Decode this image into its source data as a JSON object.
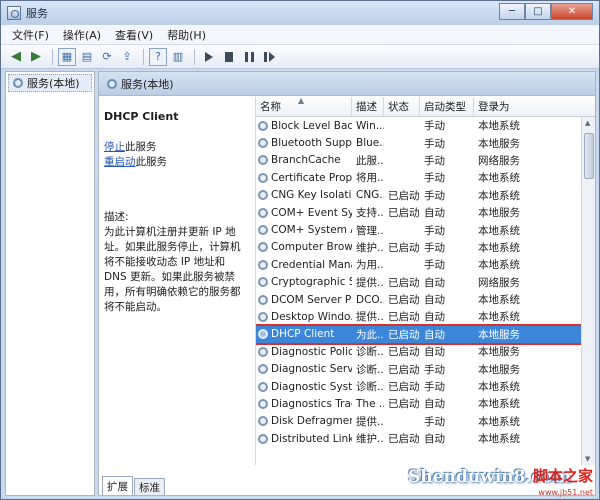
{
  "window": {
    "title": "服务"
  },
  "title_buttons": {
    "minimize": "─",
    "maximize": "□",
    "close": "✕"
  },
  "menu": [
    "文件(F)",
    "操作(A)",
    "查看(V)",
    "帮助(H)"
  ],
  "tree": {
    "root": "服务(本地)"
  },
  "main": {
    "header": "服务(本地)",
    "service_name": "DHCP Client",
    "stop_link": "停止",
    "stop_suffix": "此服务",
    "restart_link": "重启动",
    "restart_suffix": "此服务",
    "description_label": "描述:",
    "description": "为此计算机注册并更新 IP 地址。如果此服务停止，计算机将不能接收动态 IP 地址和 DNS 更新。如果此服务被禁用，所有明确依赖它的服务都将不能启动。"
  },
  "columns": [
    "名称",
    "描述",
    "状态",
    "启动类型",
    "登录为"
  ],
  "services": [
    {
      "name": "Block Level Back...",
      "desc": "Win...",
      "status": "",
      "startup": "手动",
      "logon": "本地系统"
    },
    {
      "name": "Bluetooth Supp...",
      "desc": "Blue...",
      "status": "",
      "startup": "手动",
      "logon": "本地服务"
    },
    {
      "name": "BranchCache",
      "desc": "此服...",
      "status": "",
      "startup": "手动",
      "logon": "网络服务"
    },
    {
      "name": "Certificate Propa...",
      "desc": "将用...",
      "status": "",
      "startup": "手动",
      "logon": "本地系统"
    },
    {
      "name": "CNG Key Isolation",
      "desc": "CNG...",
      "status": "已启动",
      "startup": "手动",
      "logon": "本地系统"
    },
    {
      "name": "COM+ Event Sys...",
      "desc": "支持...",
      "status": "已启动",
      "startup": "自动",
      "logon": "本地服务"
    },
    {
      "name": "COM+ System A...",
      "desc": "管理...",
      "status": "",
      "startup": "手动",
      "logon": "本地系统"
    },
    {
      "name": "Computer Brow...",
      "desc": "维护...",
      "status": "已启动",
      "startup": "手动",
      "logon": "本地系统"
    },
    {
      "name": "Credential Mana...",
      "desc": "为用...",
      "status": "",
      "startup": "手动",
      "logon": "本地系统"
    },
    {
      "name": "Cryptographic S...",
      "desc": "提供...",
      "status": "已启动",
      "startup": "自动",
      "logon": "网络服务"
    },
    {
      "name": "DCOM Server Pr...",
      "desc": "DCO...",
      "status": "已启动",
      "startup": "自动",
      "logon": "本地系统"
    },
    {
      "name": "Desktop Windo...",
      "desc": "提供...",
      "status": "已启动",
      "startup": "自动",
      "logon": "本地系统"
    },
    {
      "name": "DHCP Client",
      "desc": "为此...",
      "status": "已启动",
      "startup": "自动",
      "logon": "本地服务",
      "selected": true
    },
    {
      "name": "Diagnostic Polic...",
      "desc": "诊断...",
      "status": "已启动",
      "startup": "自动",
      "logon": "本地服务"
    },
    {
      "name": "Diagnostic Servi...",
      "desc": "诊断...",
      "status": "已启动",
      "startup": "手动",
      "logon": "本地服务"
    },
    {
      "name": "Diagnostic Syste...",
      "desc": "诊断...",
      "status": "已启动",
      "startup": "手动",
      "logon": "本地系统"
    },
    {
      "name": "Diagnostics Trac...",
      "desc": "The ...",
      "status": "已启动",
      "startup": "自动",
      "logon": "本地系统"
    },
    {
      "name": "Disk Defragmen...",
      "desc": "提供...",
      "status": "",
      "startup": "手动",
      "logon": "本地系统"
    },
    {
      "name": "Distributed Link ...",
      "desc": "维护...",
      "status": "已启动",
      "startup": "自动",
      "logon": "本地系统"
    }
  ],
  "tabs": [
    "扩展",
    "标准"
  ],
  "watermark": {
    "text": "Shenduwin8.com",
    "cn": "脚本之家",
    "small": "www.jb51.net"
  }
}
